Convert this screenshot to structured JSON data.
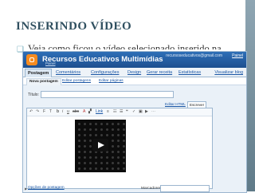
{
  "slide": {
    "title": "INSERINDO VÍDEO",
    "bullet": "Veja como ficou o vídeo selecionado inserido na"
  },
  "blogger": {
    "blog_name": "Recursos Educativos Multimídias",
    "user_email": "recursoseducativos@gmail.com",
    "header_link": "Painel",
    "dashboard_link": "Painel",
    "main_tabs": [
      "Postagem",
      "Comentários",
      "Configurações",
      "Design",
      "Gerar receita",
      "Estatísticas"
    ],
    "view_blog": "Visualizar blog",
    "sub_tabs": [
      "Nova postagem",
      "Editar postagens",
      "Editar páginas"
    ],
    "title_label": "Título:",
    "mode_tabs": [
      "Editar HTML",
      "Escrever"
    ],
    "toolbar": {
      "link": "Link"
    },
    "post_options": "Opções de postagem",
    "labels_label": "Marcadores:"
  },
  "colors": {
    "header_blue": "#2e6fb7",
    "link_blue": "#1a56a5",
    "title_color": "#2f4f5f",
    "logo_orange": "#f68b1f"
  },
  "icons": [
    "play-icon",
    "blogger-logo-icon",
    "bullet-icon"
  ]
}
